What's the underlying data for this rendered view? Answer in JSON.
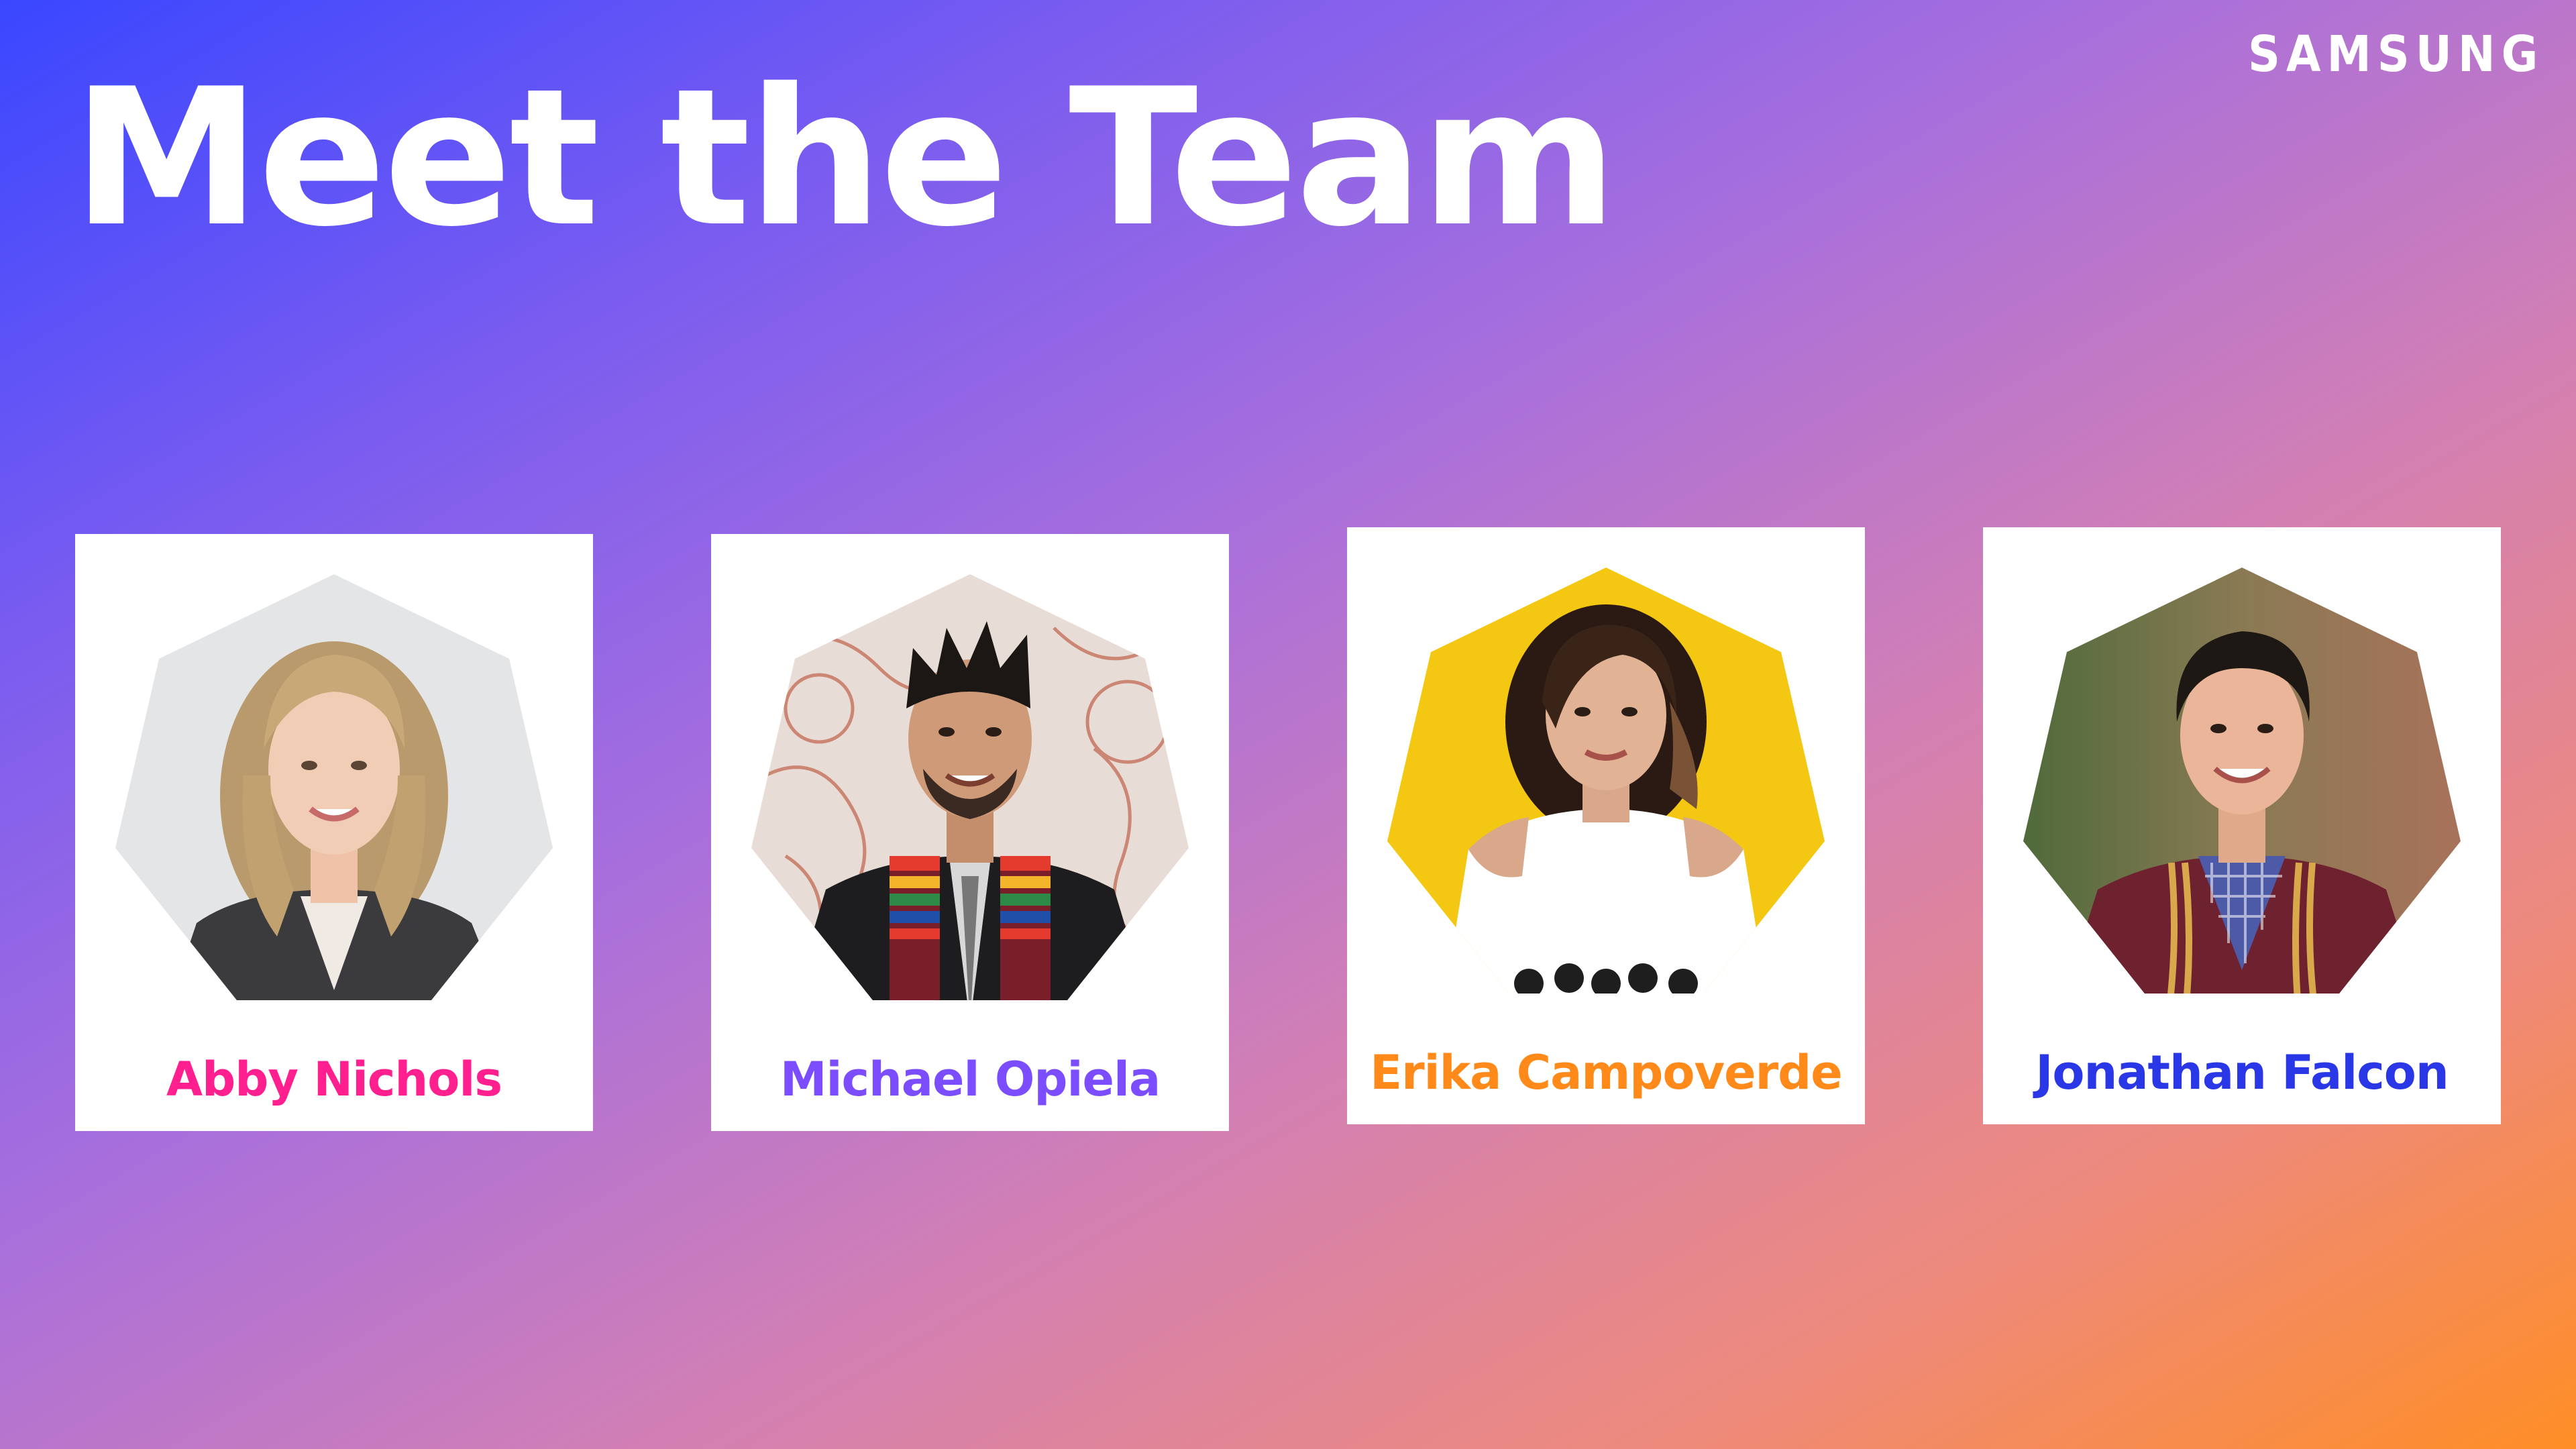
{
  "slide": {
    "title": "Meet the Team",
    "brand_logo": "SAMSUNG"
  },
  "colors": {
    "gradient_start": "#3a47ff",
    "gradient_end": "#ff8e26",
    "card_background": "#ffffff"
  },
  "team": [
    {
      "name": "Abby Nichols",
      "color": "#ff1f8e",
      "photo_icon": "person-portrait-icon"
    },
    {
      "name": "Michael Opiela",
      "color": "#7b4dff",
      "photo_icon": "person-portrait-icon"
    },
    {
      "name": "Erika Campoverde",
      "color": "#ff8a1a",
      "photo_icon": "person-portrait-icon"
    },
    {
      "name": "Jonathan Falcon",
      "color": "#2a37e6",
      "photo_icon": "person-portrait-icon"
    }
  ]
}
